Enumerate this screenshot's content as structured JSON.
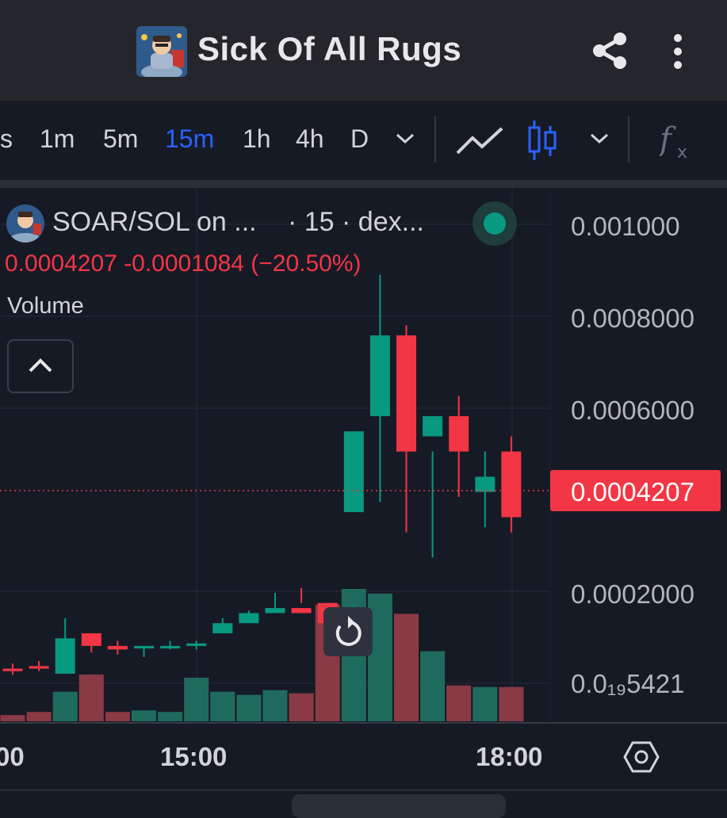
{
  "header": {
    "title": "Sick Of All Rugs",
    "icons": [
      "share-icon",
      "more-vertical-icon"
    ]
  },
  "toolbar": {
    "timeframes": [
      "s",
      "1m",
      "5m",
      "15m",
      "1h",
      "4h",
      "D"
    ],
    "active_timeframe": "15m",
    "icons": [
      "chevron-down-icon",
      "line-chart-icon",
      "candlestick-icon",
      "chevron-down-icon",
      "indicators-fx-icon"
    ]
  },
  "legend": {
    "pair": "SOAR/SOL on ...",
    "interval": "· 15 · dex...",
    "price_line": "0.0004207  -0.0001084 (−20.50%)",
    "volume_label": "Volume",
    "collapse_icon": "chevron-up-icon",
    "status": "connected"
  },
  "colors": {
    "up": "#089981",
    "down": "#f23645",
    "active": "#2962ff",
    "background": "#161a25"
  },
  "chart_data": {
    "type": "candlestick",
    "ylabel_ticks": [
      "0.001000",
      "0.0008000",
      "0.0006000",
      "0.0002000",
      "0.0₁₉5421"
    ],
    "y_ticks_values": [
      0.001,
      0.0008,
      0.0006,
      0.0002,
      0.0
    ],
    "xlabel_ticks": [
      "00",
      "15:00",
      "18:00"
    ],
    "current_price": "0.0004207",
    "ylim": [
      0.0,
      0.001
    ],
    "series": {
      "open": [
        0.00012,
        0.000125,
        0.00011,
        0.00019,
        0.000165,
        0.00016,
        0.00016,
        0.000165,
        0.00019,
        0.00021,
        0.00023,
        0.00024,
        0.00025,
        0.00043,
        0.00062,
        0.00078,
        0.00058,
        0.00062,
        0.00047,
        0.00055
      ],
      "high": [
        0.00013,
        0.000135,
        0.00022,
        0.00019,
        0.000175,
        0.00016,
        0.000175,
        0.000175,
        0.00022,
        0.000235,
        0.00027,
        0.00028,
        0.000243,
        0.000235,
        0.0009,
        0.0008,
        0.00055,
        0.00066,
        0.00055,
        0.00058
      ],
      "low": [
        0.000108,
        0.000115,
        0.00011,
        0.000152,
        0.000148,
        0.000143,
        0.000158,
        0.000158,
        0.00019,
        0.00021,
        0.00023,
        0.00025,
        0.00021,
        0.000245,
        0.00045,
        0.00039,
        0.00034,
        0.00046,
        0.0004,
        0.00039
      ],
      "close": [
        0.000115,
        0.00012,
        0.00018,
        0.000165,
        0.000158,
        0.000165,
        0.000165,
        0.00017,
        0.00021,
        0.00023,
        0.00024,
        0.00023,
        0.00021,
        0.00059,
        0.00078,
        0.00055,
        0.00062,
        0.00055,
        0.0005,
        0.00042
      ],
      "volume": [
        4,
        6,
        19,
        30,
        6,
        7,
        6,
        28,
        19,
        17,
        20,
        18,
        75,
        85,
        82,
        69,
        45,
        23,
        22,
        22
      ]
    }
  }
}
